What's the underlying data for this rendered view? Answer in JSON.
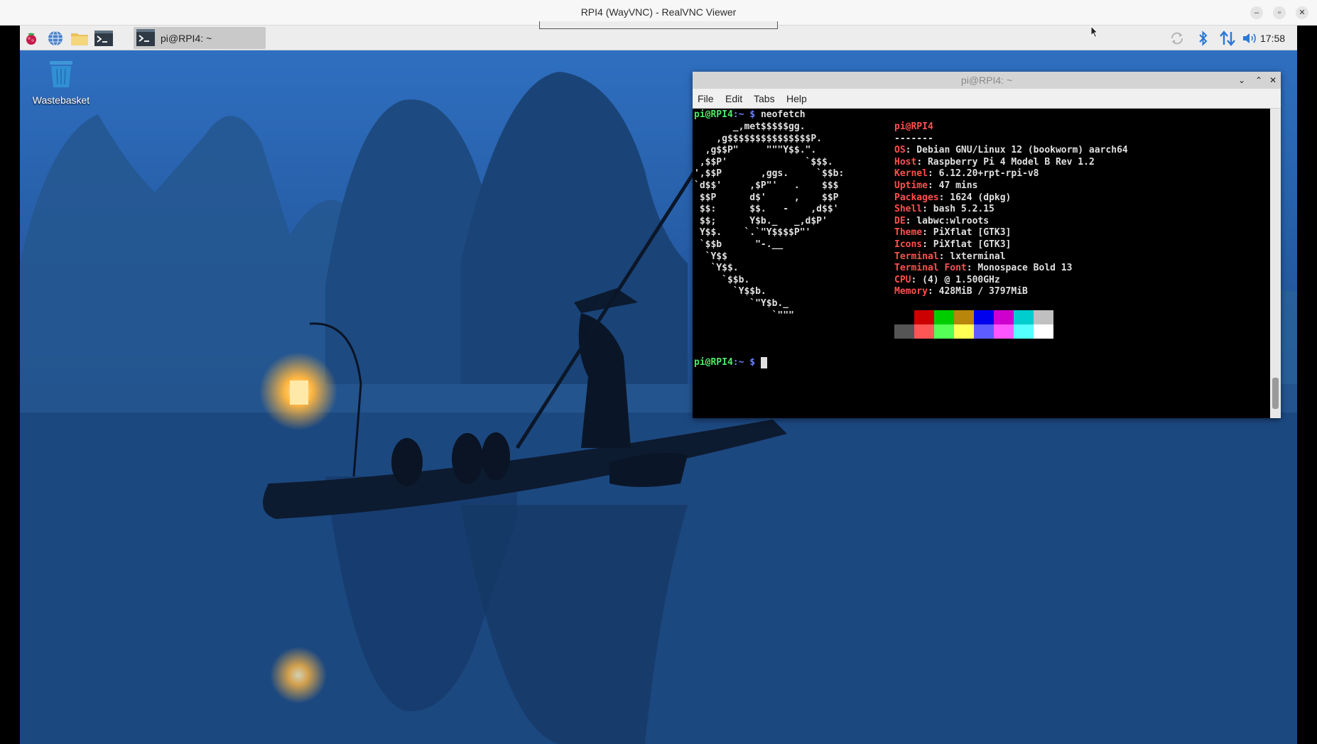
{
  "viewer": {
    "title": "RPI4 (WayVNC) - RealVNC Viewer",
    "minimize_glyph": "–",
    "maximize_glyph": "▫",
    "close_glyph": "✕"
  },
  "taskbar": {
    "launchers": [
      "raspberry-menu-icon",
      "web-browser-icon",
      "file-manager-icon",
      "terminal-icon"
    ],
    "task_label": "pi@RPI4: ~",
    "tray_icons": [
      "update-icon",
      "bluetooth-icon",
      "network-icon",
      "volume-icon"
    ],
    "clock": "17:58"
  },
  "desktop": {
    "wastebasket_label": "Wastebasket"
  },
  "terminal": {
    "title": "pi@RPI4: ~",
    "window_buttons": [
      "⌄",
      "⌃",
      "✕"
    ],
    "menu": [
      "File",
      "Edit",
      "Tabs",
      "Help"
    ],
    "prompt_user": "pi@RPI4",
    "prompt_path": ":~ ",
    "prompt_symbol": "$ ",
    "command": "neofetch",
    "logo": [
      "       _,met$$$$$gg.",
      "    ,g$$$$$$$$$$$$$$$P.",
      "  ,g$$P\"     \"\"\"Y$$.\".",
      " ,$$P'              `$$$.",
      "',$$P       ,ggs.     `$$b:",
      "`d$$'     ,$P\"'   .    $$$",
      " $$P      d$'     ,    $$P",
      " $$:      $$.   -    ,d$$'",
      " $$;      Y$b._   _,d$P'",
      " Y$$.    `.`\"Y$$$$P\"'",
      " `$$b      \"-.__",
      "  `Y$$",
      "   `Y$$.",
      "     `$$b.",
      "       `Y$$b.",
      "          `\"Y$b._",
      "              `\"\"\""
    ],
    "user_host": "pi@RPI4",
    "separator": "-------",
    "info": [
      {
        "key": "OS",
        "value": ": Debian GNU/Linux 12 (bookworm) aarch64"
      },
      {
        "key": "Host",
        "value": ": Raspberry Pi 4 Model B Rev 1.2"
      },
      {
        "key": "Kernel",
        "value": ": 6.12.20+rpt-rpi-v8"
      },
      {
        "key": "Uptime",
        "value": ": 47 mins"
      },
      {
        "key": "Packages",
        "value": ": 1624 (dpkg)"
      },
      {
        "key": "Shell",
        "value": ": bash 5.2.15"
      },
      {
        "key": "DE",
        "value": ": labwc:wlroots"
      },
      {
        "key": "Theme",
        "value": ": PiXflat [GTK3]"
      },
      {
        "key": "Icons",
        "value": ": PiXflat [GTK3]"
      },
      {
        "key": "Terminal",
        "value": ": lxterminal"
      },
      {
        "key": "Terminal Font",
        "value": ": Monospace Bold 13"
      },
      {
        "key": "CPU",
        "value": ": (4) @ 1.500GHz"
      },
      {
        "key": "Memory",
        "value": ": 428MiB / 3797MiB"
      }
    ],
    "palette_dark": [
      "#000000",
      "#cd0000",
      "#00cd00",
      "#b8860b",
      "#0000ee",
      "#cd00cd",
      "#00cdcd",
      "#c0c0c0"
    ],
    "palette_bright": [
      "#555555",
      "#ff5555",
      "#55ff55",
      "#ffff55",
      "#5c5cff",
      "#ff55ff",
      "#55ffff",
      "#ffffff"
    ]
  },
  "colors": {
    "prompt_green": "#50e86a",
    "prompt_blue": "#6b82ff",
    "neofetch_red": "#ff4f4f"
  }
}
